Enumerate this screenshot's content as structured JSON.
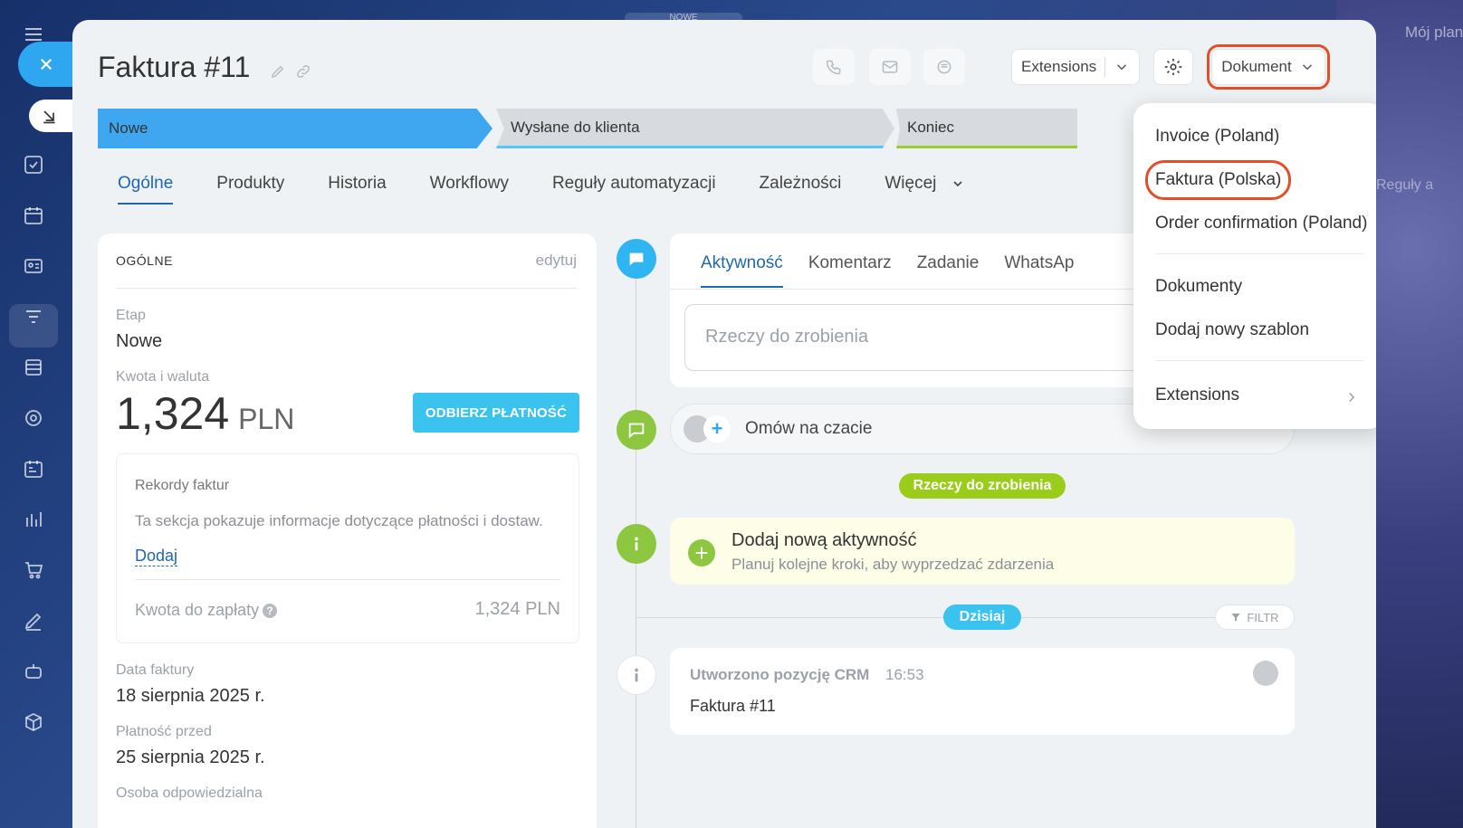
{
  "background": {
    "top_label": "NOWE",
    "right_text": "Mój plan",
    "right_text_2": "Reguły a"
  },
  "header": {
    "title": "Faktura #11",
    "extensions_label": "Extensions",
    "dokument_label": "Dokument"
  },
  "stages": [
    {
      "label": "Nowe"
    },
    {
      "label": "Wysłane do klienta"
    },
    {
      "label": "Koniec"
    }
  ],
  "tabs": [
    {
      "label": "Ogólne"
    },
    {
      "label": "Produkty"
    },
    {
      "label": "Historia"
    },
    {
      "label": "Workflowy"
    },
    {
      "label": "Reguły automatyzacji"
    },
    {
      "label": "Zależności"
    },
    {
      "label": "Więcej"
    }
  ],
  "general": {
    "heading": "OGÓLNE",
    "edit": "edytuj",
    "stage_label": "Etap",
    "stage_value": "Nowe",
    "amount_label": "Kwota i waluta",
    "amount_value": "1,324",
    "amount_currency": "PLN",
    "pay_button": "ODBIERZ PŁATNOŚĆ",
    "records_title": "Rekordy faktur",
    "records_desc": "Ta sekcja pokazuje informacje dotyczące płatności i dostaw.",
    "records_add": "Dodaj",
    "due_label": "Kwota do zapłaty",
    "due_value": "1,324 PLN",
    "invoice_date_label": "Data faktury",
    "invoice_date_value": "18 sierpnia 2025 r.",
    "pay_before_label": "Płatność przed",
    "pay_before_value": "25 sierpnia 2025 r.",
    "responsible_label": "Osoba odpowiedzialna"
  },
  "activity": {
    "tabs": [
      "Aktywność",
      "Komentarz",
      "Zadanie",
      "WhatsAp"
    ],
    "input_placeholder": "Rzeczy do zrobienia",
    "chat_label": "Omów na czacie",
    "todo_pill": "Rzeczy do zrobienia",
    "add_title": "Dodaj nową aktywność",
    "add_subtitle": "Planuj kolejne kroki, aby wyprzedzać zdarzenia",
    "today_pill": "Dzisiaj",
    "filter_label": "FILTR",
    "log_title": "Utworzono pozycję CRM",
    "log_time": "16:53",
    "log_body": "Faktura #11"
  },
  "dropdown": {
    "items": [
      "Invoice (Poland)",
      "Faktura (Polska)",
      "Order confirmation (Poland)",
      "Dokumenty",
      "Dodaj nowy szablon",
      "Extensions"
    ]
  },
  "colors": {
    "accent": "#2067b0",
    "stage_active": "#3fa7ef",
    "pay_button": "#3bc3ef",
    "highlight": "#e0502a",
    "green": "#8dc63f"
  }
}
